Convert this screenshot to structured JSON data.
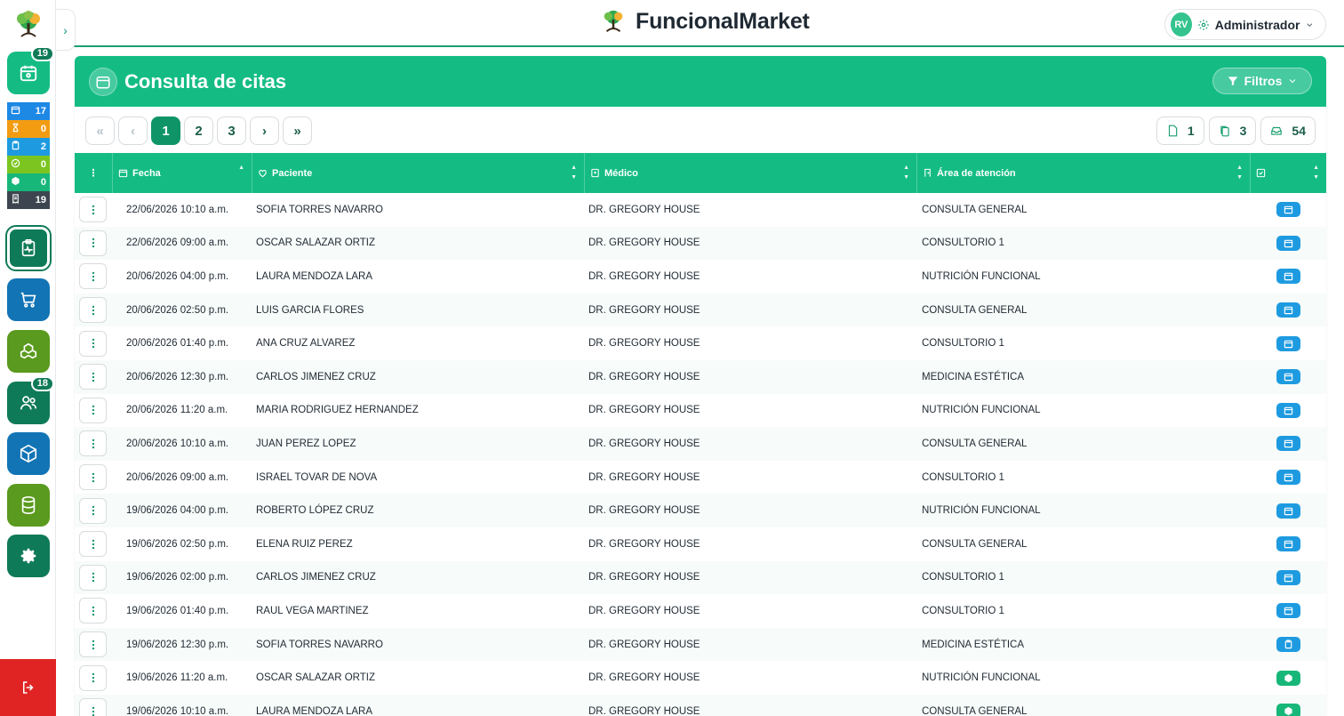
{
  "app": {
    "brand": "FuncionalMarket"
  },
  "user": {
    "initials": "RV",
    "role": "Administrador"
  },
  "sidebar": {
    "calendar_badge": "19",
    "patients_badge": "18",
    "stats": [
      {
        "icon": "calendar-icon",
        "value": "17",
        "color": "#1e88e5"
      },
      {
        "icon": "hourglass-icon",
        "value": "0",
        "color": "#f39c12"
      },
      {
        "icon": "clipboard-icon",
        "value": "2",
        "color": "#1e9be0"
      },
      {
        "icon": "check-circle-icon",
        "value": "0",
        "color": "#7cc520"
      },
      {
        "icon": "box-icon",
        "value": "0",
        "color": "#17b77a"
      },
      {
        "icon": "receipt-icon",
        "value": "19",
        "color": "#3d4650"
      }
    ]
  },
  "page": {
    "title": "Consulta de citas",
    "filters_label": "Filtros"
  },
  "pagination": {
    "first": "«",
    "prev": "‹",
    "next": "›",
    "last": "»",
    "pages": [
      "1",
      "2",
      "3"
    ]
  },
  "counts": {
    "page": "1",
    "pages": "3",
    "total": "54"
  },
  "table": {
    "columns": {
      "fecha": "Fecha",
      "paciente": "Paciente",
      "medico": "Médico",
      "area": "Área de atención"
    },
    "rows": [
      {
        "fecha": "22/06/2026 10:10 a.m.",
        "paciente": "SOFIA TORRES NAVARRO",
        "medico": "DR. GREGORY HOUSE",
        "area": "CONSULTA GENERAL",
        "status": "calendar"
      },
      {
        "fecha": "22/06/2026 09:00 a.m.",
        "paciente": "OSCAR SALAZAR ORTIZ",
        "medico": "DR. GREGORY HOUSE",
        "area": "CONSULTORIO 1",
        "status": "calendar"
      },
      {
        "fecha": "20/06/2026 04:00 p.m.",
        "paciente": "LAURA MENDOZA LARA",
        "medico": "DR. GREGORY HOUSE",
        "area": "NUTRICIÓN FUNCIONAL",
        "status": "calendar"
      },
      {
        "fecha": "20/06/2026 02:50 p.m.",
        "paciente": "LUIS GARCIA FLORES",
        "medico": "DR. GREGORY HOUSE",
        "area": "CONSULTA GENERAL",
        "status": "calendar"
      },
      {
        "fecha": "20/06/2026 01:40 p.m.",
        "paciente": "ANA CRUZ ALVAREZ",
        "medico": "DR. GREGORY HOUSE",
        "area": "CONSULTORIO 1",
        "status": "calendar"
      },
      {
        "fecha": "20/06/2026 12:30 p.m.",
        "paciente": "CARLOS JIMENEZ CRUZ",
        "medico": "DR. GREGORY HOUSE",
        "area": "MEDICINA ESTÉTICA",
        "status": "calendar"
      },
      {
        "fecha": "20/06/2026 11:20 a.m.",
        "paciente": "MARIA RODRIGUEZ HERNANDEZ",
        "medico": "DR. GREGORY HOUSE",
        "area": "NUTRICIÓN FUNCIONAL",
        "status": "calendar"
      },
      {
        "fecha": "20/06/2026 10:10 a.m.",
        "paciente": "JUAN PEREZ LOPEZ",
        "medico": "DR. GREGORY HOUSE",
        "area": "CONSULTA GENERAL",
        "status": "calendar"
      },
      {
        "fecha": "20/06/2026 09:00 a.m.",
        "paciente": "ISRAEL TOVAR DE NOVA",
        "medico": "DR. GREGORY HOUSE",
        "area": "CONSULTORIO 1",
        "status": "calendar"
      },
      {
        "fecha": "19/06/2026 04:00 p.m.",
        "paciente": "ROBERTO LÓPEZ CRUZ",
        "medico": "DR. GREGORY HOUSE",
        "area": "NUTRICIÓN FUNCIONAL",
        "status": "calendar"
      },
      {
        "fecha": "19/06/2026 02:50 p.m.",
        "paciente": "ELENA RUIZ PEREZ",
        "medico": "DR. GREGORY HOUSE",
        "area": "CONSULTA GENERAL",
        "status": "calendar"
      },
      {
        "fecha": "19/06/2026 02:00 p.m.",
        "paciente": "CARLOS JIMENEZ CRUZ",
        "medico": "DR. GREGORY HOUSE",
        "area": "CONSULTORIO 1",
        "status": "calendar"
      },
      {
        "fecha": "19/06/2026 01:40 p.m.",
        "paciente": "RAUL VEGA MARTINEZ",
        "medico": "DR. GREGORY HOUSE",
        "area": "CONSULTORIO 1",
        "status": "calendar"
      },
      {
        "fecha": "19/06/2026 12:30 p.m.",
        "paciente": "SOFIA TORRES NAVARRO",
        "medico": "DR. GREGORY HOUSE",
        "area": "MEDICINA ESTÉTICA",
        "status": "clipboard"
      },
      {
        "fecha": "19/06/2026 11:20 a.m.",
        "paciente": "OSCAR SALAZAR ORTIZ",
        "medico": "DR. GREGORY HOUSE",
        "area": "NUTRICIÓN FUNCIONAL",
        "status": "box"
      },
      {
        "fecha": "19/06/2026 10:10 a.m.",
        "paciente": "LAURA MENDOZA LARA",
        "medico": "DR. GREGORY HOUSE",
        "area": "CONSULTA GENERAL",
        "status": "box"
      }
    ]
  },
  "colors": {
    "primary": "#14bc84",
    "primary_dark": "#0f7a57",
    "logout": "#e02424",
    "status_blue": "#1e9be0",
    "status_green": "#17b77a"
  }
}
